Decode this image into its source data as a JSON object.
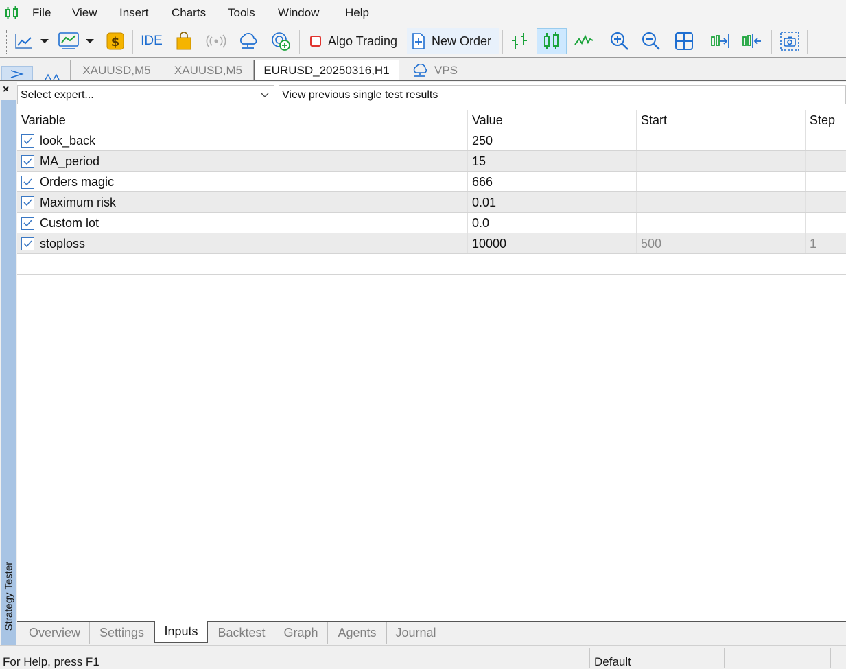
{
  "menu": {
    "items": [
      "File",
      "View",
      "Insert",
      "Charts",
      "Tools",
      "Window",
      "Help"
    ]
  },
  "toolbar": {
    "ide_label": "IDE",
    "algo_trading_label": "Algo Trading",
    "new_order_label": "New Order"
  },
  "chart_tabs": {
    "tab1": "XAUUSD,M5",
    "tab2": "XAUUSD,M5",
    "tab3": "EURUSD_20250316,H1",
    "vps": "VPS"
  },
  "tester": {
    "panel_title": "Strategy Tester",
    "expert_placeholder": "Select expert...",
    "prev_results": "View previous single test results",
    "columns": {
      "variable": "Variable",
      "value": "Value",
      "start": "Start",
      "step": "Step"
    },
    "rows": [
      {
        "name": "look_back",
        "value": "250",
        "start": "",
        "step": ""
      },
      {
        "name": "MA_period",
        "value": "15",
        "start": "",
        "step": ""
      },
      {
        "name": "Orders magic",
        "value": "666",
        "start": "",
        "step": ""
      },
      {
        "name": "Maximum risk",
        "value": "0.01",
        "start": "",
        "step": ""
      },
      {
        "name": "Custom lot",
        "value": "0.0",
        "start": "",
        "step": ""
      },
      {
        "name": "stoploss",
        "value": "10000",
        "start": "500",
        "step": "1"
      }
    ],
    "tabs": [
      "Overview",
      "Settings",
      "Inputs",
      "Backtest",
      "Graph",
      "Agents",
      "Journal"
    ]
  },
  "status": {
    "help": "For Help, press F1",
    "profile": "Default"
  },
  "colors": {
    "accent_blue": "#1f6fd1",
    "green": "#1aa33a",
    "selection": "#cde8ff",
    "side_strip": "#a8c4e4"
  }
}
